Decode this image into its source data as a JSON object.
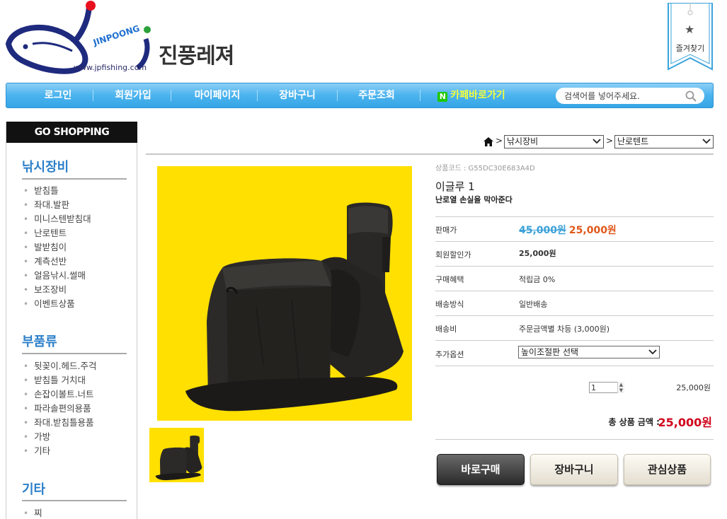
{
  "brand": {
    "name_kr": "진풍레져",
    "name_en": "JINPOONG",
    "url": "www.jpfishing.com"
  },
  "bookmark": {
    "label": "즐겨찾기",
    "icon": "star-icon"
  },
  "nav": {
    "items": [
      "로그인",
      "회원가입",
      "마이페이지",
      "장바구니",
      "주문조회"
    ],
    "cafe": {
      "badge": "N",
      "label": "카페바로가기"
    },
    "search_placeholder": "검색어를 넣어주세요."
  },
  "sidebar": {
    "header": "GO SHOPPING",
    "categories": [
      {
        "title": "낚시장비",
        "items": [
          "받침틀",
          "좌대.발판",
          "미니스텐받침대",
          "난로텐트",
          "발받침이",
          "계측선반",
          "얼음낚시.썰매",
          "보조장비",
          "이벤트상품"
        ]
      },
      {
        "title": "부품류",
        "items": [
          "뒷꽂이.헤드.주걱",
          "받침틀 거치대",
          "손잡이볼트.너트",
          "파라솔편의용품",
          "좌대.받침틀용품",
          "가방",
          "기타"
        ]
      },
      {
        "title": "기타",
        "items": [
          "찌"
        ]
      }
    ]
  },
  "breadcrumb": {
    "level1": "낚시장비",
    "level2": "난로텐트"
  },
  "product": {
    "code": "상품코드 : G55DC30E683A4D",
    "name": "이글루 1",
    "desc": "난로열 손실을 막아준다",
    "rows": {
      "price_label": "판매가",
      "price_old": "45,000원",
      "price_new": "25,000원",
      "member_label": "회원할인가",
      "member_price": "25,000원",
      "benefit_label": "구매혜택",
      "benefit_value": "적립금 0%",
      "ship_method_label": "배송방식",
      "ship_method_value": "일반배송",
      "ship_fee_label": "배송비",
      "ship_fee_value": "주문금액별 차등 (3,000원)",
      "option_label": "추가옵션",
      "option_selected": "높이조절판 선택"
    },
    "quantity": "1",
    "line_price": "25,000원",
    "total_label": "총 상품 금액 :",
    "total_value": "25,000원"
  },
  "buttons": {
    "buy": "바로구매",
    "cart": "장바구니",
    "wish": "관심상품"
  },
  "colors": {
    "nav_blue": "#4ab3ee",
    "category_blue": "#2b7fc9",
    "price_red": "#d0021b",
    "product_bg": "#ffe000"
  }
}
